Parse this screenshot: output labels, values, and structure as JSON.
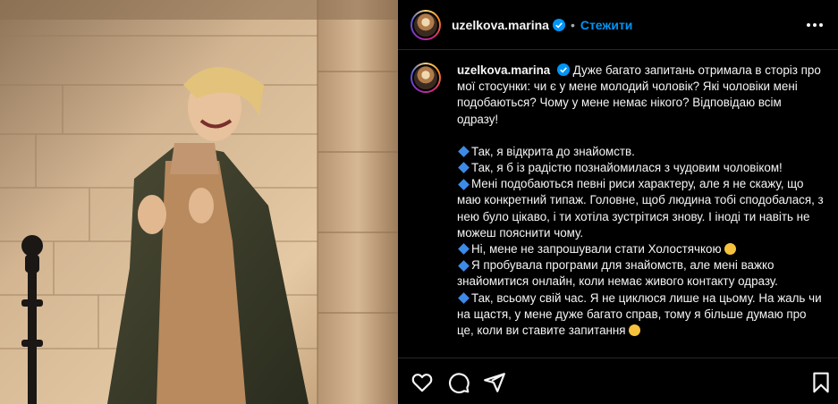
{
  "post": {
    "username": "uzelkova.marina",
    "separator": "•",
    "follow_label": "Стежити",
    "caption": {
      "username": "uzelkova.marina",
      "intro": "Дуже багато запитань отримала в сторіз про мої стосунки: чи є у мене молодий чоловік? Які чоловіки мені подобаються? Чому у мене немає нікого? Відповідаю всім одразу!",
      "bullets": [
        "Так, я відкрита до знайомств.",
        "Так, я б із радістю познайомилася з чудовим чоловіком!",
        "Мені подобаються певні риси характеру, але я не скажу, що маю конкретний типаж. Головне, щоб людина тобі сподобалася, з нею було цікаво, і ти хотіла зустрітися знову. І іноді ти навіть не можеш пояснити чому.",
        "Ні, мене не запрошували стати Холостячкою",
        "Я пробувала програми для знайомств, але мені важко знайомитися онлайн, коли немає живого контакту одразу.",
        "Так, всьому свій час. Я не циклюся лише на цьому. На жаль чи на щастя, у мене дуже багато справ, тому я більше думаю про це, коли ви ставите запитання"
      ]
    },
    "icons": {
      "verified": "verified-badge-icon",
      "more": "more-options-icon",
      "like": "heart-icon",
      "comment": "comment-icon",
      "share": "share-icon",
      "save": "bookmark-icon",
      "bullet": "blue-diamond-icon"
    },
    "colors": {
      "background": "#000000",
      "accent": "#0095f6",
      "verified": "#0095f6",
      "bullet": "#3d8be8"
    }
  }
}
